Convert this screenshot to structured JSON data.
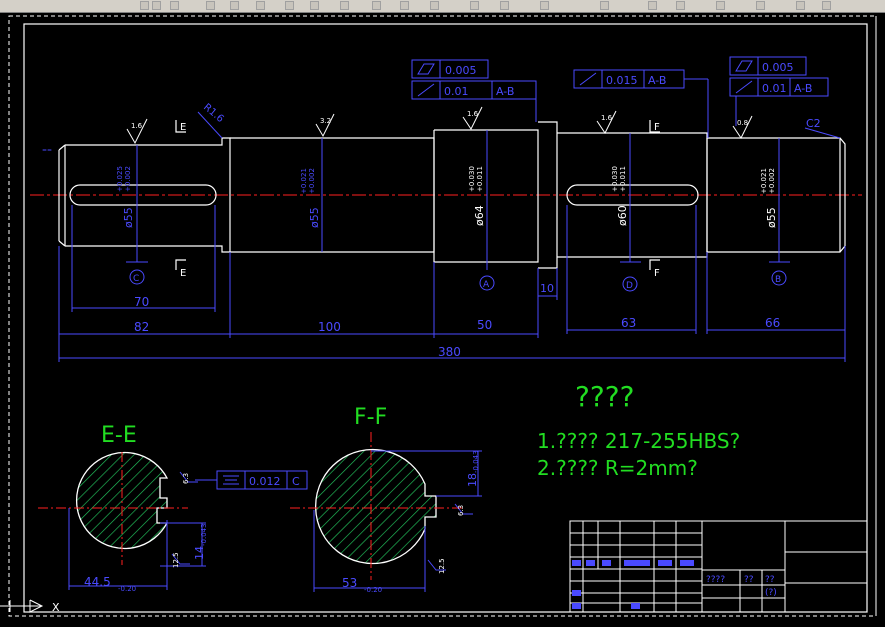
{
  "colors": {
    "background": "#000000",
    "outline": "#ffffff",
    "dimension": "#4a4aff",
    "centerline": "#ff2020",
    "hatch": "#22c55e",
    "text_green": "#22dd22",
    "toolbar": "#d4d0c8"
  },
  "dims": {
    "d70": "70",
    "d82": "82",
    "d100": "100",
    "d50": "50",
    "d10": "10",
    "d63": "63",
    "d66": "66",
    "d380": "380",
    "dia1": "ø55",
    "dia1_tol_up": "+0.025",
    "dia1_tol_lo": "+0.002",
    "dia2": "ø55",
    "dia2_tol_up": "+0.021",
    "dia2_tol_lo": "+0.002",
    "dia3": "ø64",
    "dia3_tol_up": "+0.030",
    "dia3_tol_lo": "+0.011",
    "dia4": "ø60",
    "dia4_tol_up": "+0.030",
    "dia4_tol_lo": "+0.011",
    "dia5": "ø55",
    "dia5_tol_up": "+0.021",
    "dia5_tol_lo": "+0.002"
  },
  "roughness": {
    "r1": "1.6",
    "r2": "3.2",
    "r3": "1.6",
    "r4": "1.6",
    "r5": "0.8"
  },
  "labels": {
    "r16": "R1.6",
    "c2": "C2",
    "datum_a": "A",
    "datum_b": "B",
    "datum_c": "C",
    "datum_d": "D",
    "sec_e": "E",
    "sec_f": "F",
    "section_ee": "E-E",
    "section_ff": "F-F"
  },
  "tolerance_frames": {
    "f1a": "0.005",
    "f1b": "0.01",
    "f1b_ref": "A-B",
    "f2": "0.015",
    "f2_ref": "A-B",
    "f3a": "0.005",
    "f3b": "0.01",
    "f3b_ref": "A-B",
    "f4": "0.012",
    "f4_ref": "C"
  },
  "notes": {
    "title": "????",
    "line1": "1.???? 217-255HBS?",
    "line2": "2.???? R=2mm?"
  },
  "sections": {
    "ee_width": "44.5",
    "ee_width_tol": "-0.20",
    "ee_key": "14",
    "ee_key_tol": "-0.043",
    "ee_rough1": "6.3",
    "ee_rough2": "12.5",
    "ff_width": "53",
    "ff_width_tol": "-0.20",
    "ff_key": "18",
    "ff_key_tol": "-0.043",
    "ff_rough1": "6.3",
    "ff_rough2": "12.5"
  },
  "title_block": {
    "cell_part": "????",
    "cell_scale": "??",
    "cell_qty": "??",
    "cell_code": "(?)"
  },
  "ucs": {
    "x_label": "X"
  }
}
